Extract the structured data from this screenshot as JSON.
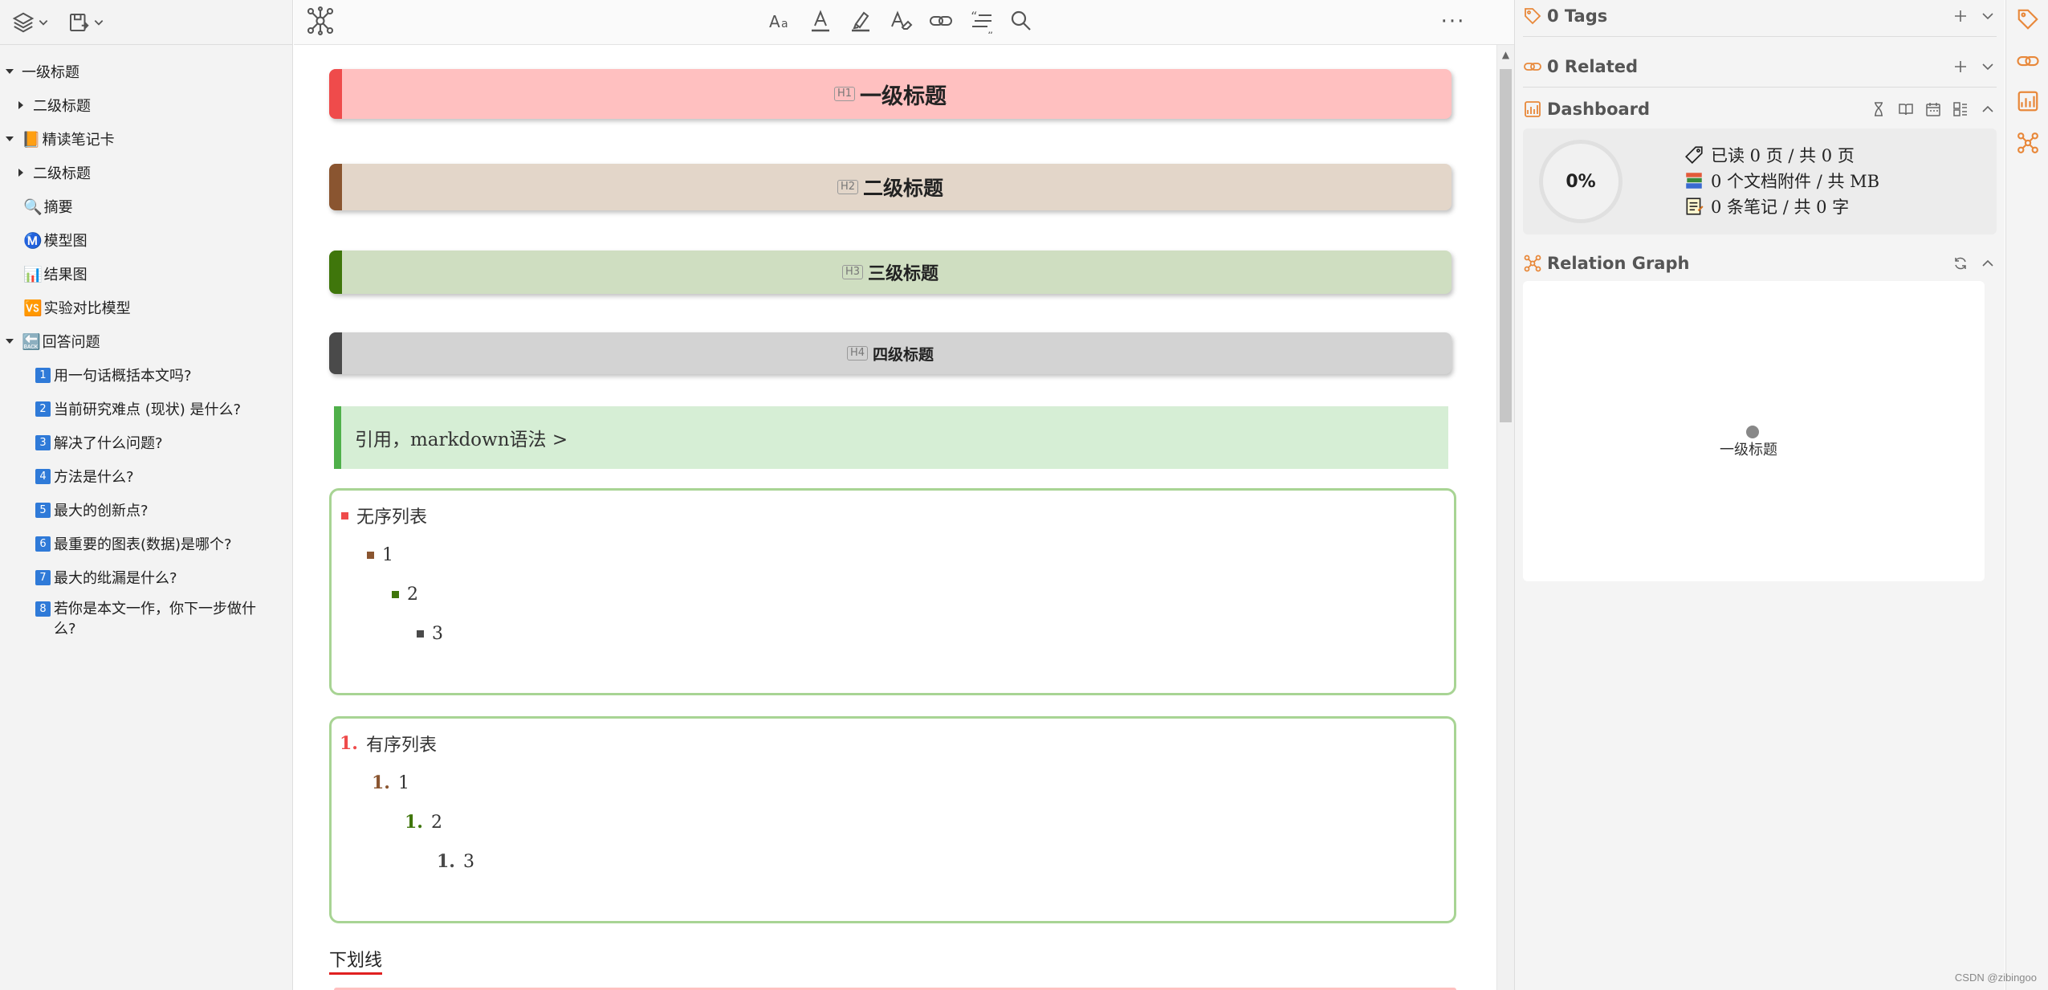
{
  "outline": {
    "items": [
      {
        "label": "一级标题",
        "icon": "",
        "badge": ""
      },
      {
        "label": "二级标题",
        "icon": "",
        "badge": ""
      },
      {
        "label": "精读笔记卡",
        "icon": "📙",
        "badge": ""
      },
      {
        "label": "二级标题",
        "icon": "",
        "badge": ""
      },
      {
        "label": "摘要",
        "icon": "🔍",
        "badge": ""
      },
      {
        "label": "模型图",
        "icon": "Ⓜ️",
        "badge": ""
      },
      {
        "label": "结果图",
        "icon": "📊",
        "badge": ""
      },
      {
        "label": "实验对比模型",
        "icon": "🆚",
        "badge": ""
      },
      {
        "label": "回答问题",
        "icon": "🔙",
        "badge": ""
      },
      {
        "label": "用一句话概括本文吗?",
        "icon": "",
        "badge": "1"
      },
      {
        "label": "当前研究难点 (现状) 是什么?",
        "icon": "",
        "badge": "2"
      },
      {
        "label": "解决了什么问题?",
        "icon": "",
        "badge": "3"
      },
      {
        "label": "方法是什么?",
        "icon": "",
        "badge": "4"
      },
      {
        "label": "最大的创新点?",
        "icon": "",
        "badge": "5"
      },
      {
        "label": "最重要的图表(数据)是哪个?",
        "icon": "",
        "badge": "6"
      },
      {
        "label": "最大的纰漏是什么?",
        "icon": "",
        "badge": "7"
      },
      {
        "label": "若你是本文一作，你下一步做什么?",
        "icon": "",
        "badge": "8"
      }
    ]
  },
  "editor": {
    "more_label": "···",
    "headings": [
      {
        "tag": "H1",
        "text": "一级标题"
      },
      {
        "tag": "H2",
        "text": "二级标题"
      },
      {
        "tag": "H3",
        "text": "三级标题"
      },
      {
        "tag": "H4",
        "text": "四级标题"
      }
    ],
    "quote": "引用，markdown语法 >",
    "unordered": [
      "无序列表",
      "1",
      "2",
      "3"
    ],
    "ordered": {
      "marker": "1.",
      "items": [
        "有序列表",
        "1",
        "2",
        "3"
      ]
    },
    "underline_text": "下划线"
  },
  "right": {
    "tags_label": "0 Tags",
    "related_label": "0 Related",
    "dashboard_label": "Dashboard",
    "progress": "0%",
    "stat_pages": "已读 0 页 / 共 0 页",
    "stat_attach": "0 个文档附件 / 共 MB",
    "stat_notes": "0 条笔记 / 共 0 字",
    "graph_label": "Relation Graph",
    "graph_node": "一级标题"
  },
  "colors": {
    "accent": "#e8883a",
    "h1": "#ef4b4b",
    "h2": "#8a5530",
    "h3": "#3f760b",
    "h4": "#4a4a4a",
    "quote_bar": "#4fb04a",
    "underline": "#e02020"
  },
  "watermark": "CSDN @zibingoo"
}
